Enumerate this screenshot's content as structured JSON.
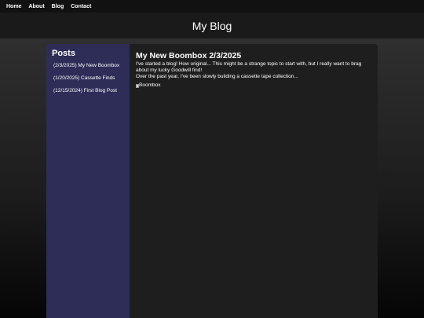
{
  "nav": {
    "items": [
      {
        "label": "Home"
      },
      {
        "label": "About"
      },
      {
        "label": "Blog"
      },
      {
        "label": "Contact"
      }
    ]
  },
  "header": {
    "title": "My Blog"
  },
  "sidebar": {
    "title": "Posts",
    "items": [
      {
        "label": "(2/3/2025) My New Boombox"
      },
      {
        "label": "(1/20/2025) Cassette Finds"
      },
      {
        "label": "(12/15/2024) First Blog Post"
      }
    ]
  },
  "post": {
    "title": "My New Boombox 2/3/2025",
    "paragraph_1": "I've started a blog! How original... This might be a strange topic to start with, but I really want to brag about my lucky Goodwill find!",
    "paragraph_2": "Over the past year, I've been slowly building a cassette tape collection...",
    "image_alt": "Boombox",
    "image_icon": "broken-image-icon"
  },
  "colors": {
    "nav_bg": "#111111",
    "header_bg": "#1a1a1a",
    "sidebar_bg": "#2e2d58",
    "main_bg": "#1e1e1e",
    "text": "#ffffff"
  }
}
